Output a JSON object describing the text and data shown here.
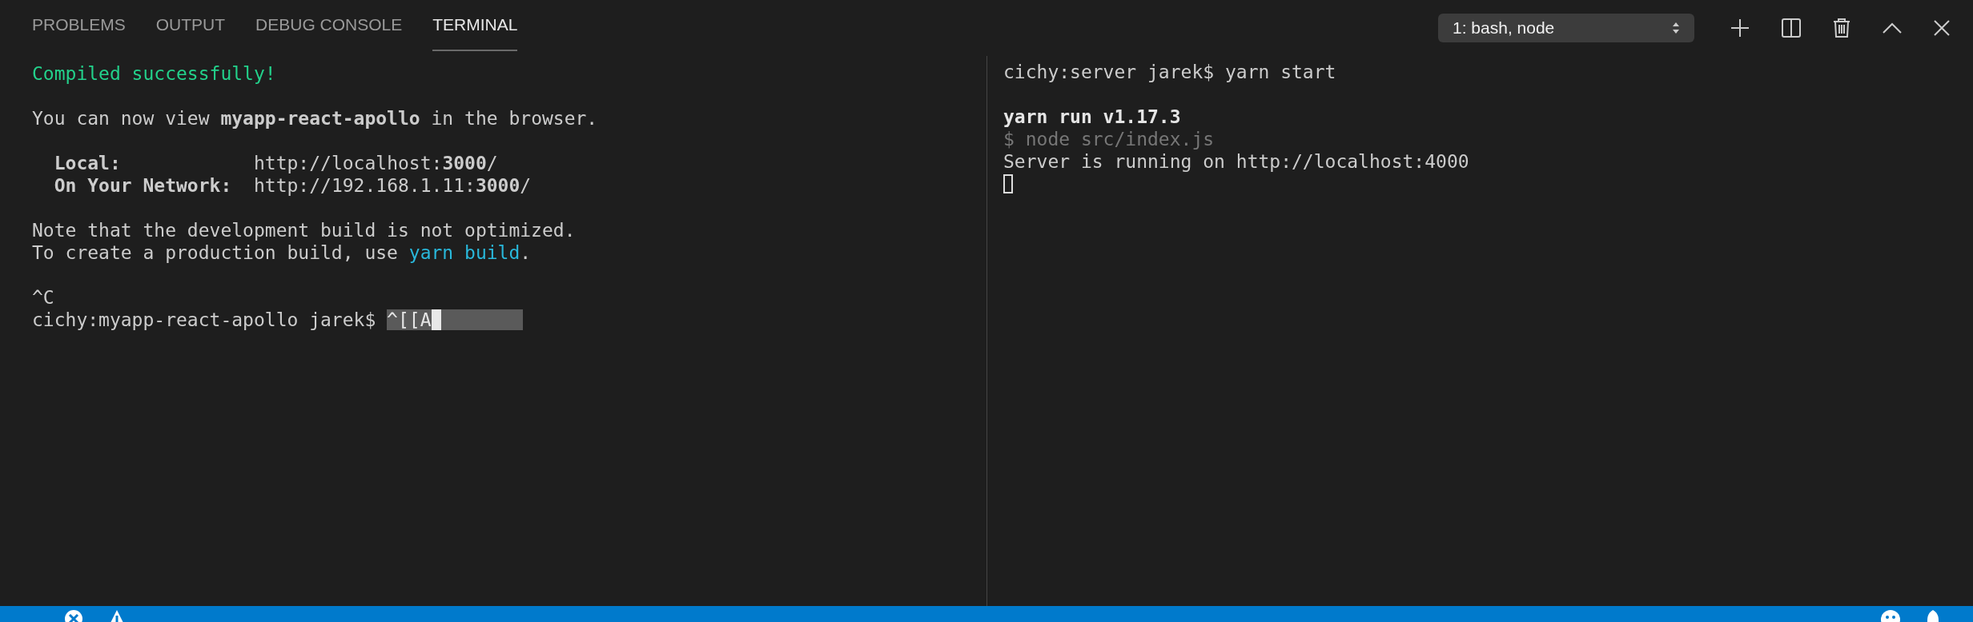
{
  "tabs": [
    {
      "label": "PROBLEMS",
      "selected": false
    },
    {
      "label": "OUTPUT",
      "selected": false
    },
    {
      "label": "DEBUG CONSOLE",
      "selected": false
    },
    {
      "label": "TERMINAL",
      "selected": true
    }
  ],
  "terminal_select": {
    "value": "1: bash, node"
  },
  "panes": [
    {
      "lines": [
        {
          "kind": "success",
          "text": "Compiled successfully!"
        },
        {
          "kind": "gap"
        },
        {
          "kind": "normal",
          "text": "You can now view **myapp-react-apollo** in the browser."
        },
        {
          "kind": "gap"
        },
        {
          "kind": "normal",
          "text": "  **Local:**            http://localhost:**3000**/"
        },
        {
          "kind": "normal",
          "text": "  **On Your Network:**  http://192.168.1.11:**3000**/"
        },
        {
          "kind": "gap"
        },
        {
          "kind": "normal",
          "text": "Note that the development build is not optimized."
        },
        {
          "kind": "link",
          "text": "To create a production build, use ",
          "link": "yarn build",
          "after": "."
        },
        {
          "kind": "gap"
        },
        {
          "kind": "normal",
          "text": "^C"
        },
        {
          "kind": "prompt",
          "text": "cichy:myapp-react-apollo jarek$ ",
          "input": "^[[A",
          "selection": true
        }
      ]
    },
    {
      "lines": [
        {
          "kind": "normal",
          "text": "cichy:server jarek$ yarn start"
        },
        {
          "kind": "gap"
        },
        {
          "kind": "bold",
          "text": "yarn run v1.17.3"
        },
        {
          "kind": "dim",
          "text": "$ node src/index.js"
        },
        {
          "kind": "normal",
          "text": "Server is running on http://localhost:4000"
        },
        {
          "kind": "cursor"
        }
      ]
    }
  ]
}
